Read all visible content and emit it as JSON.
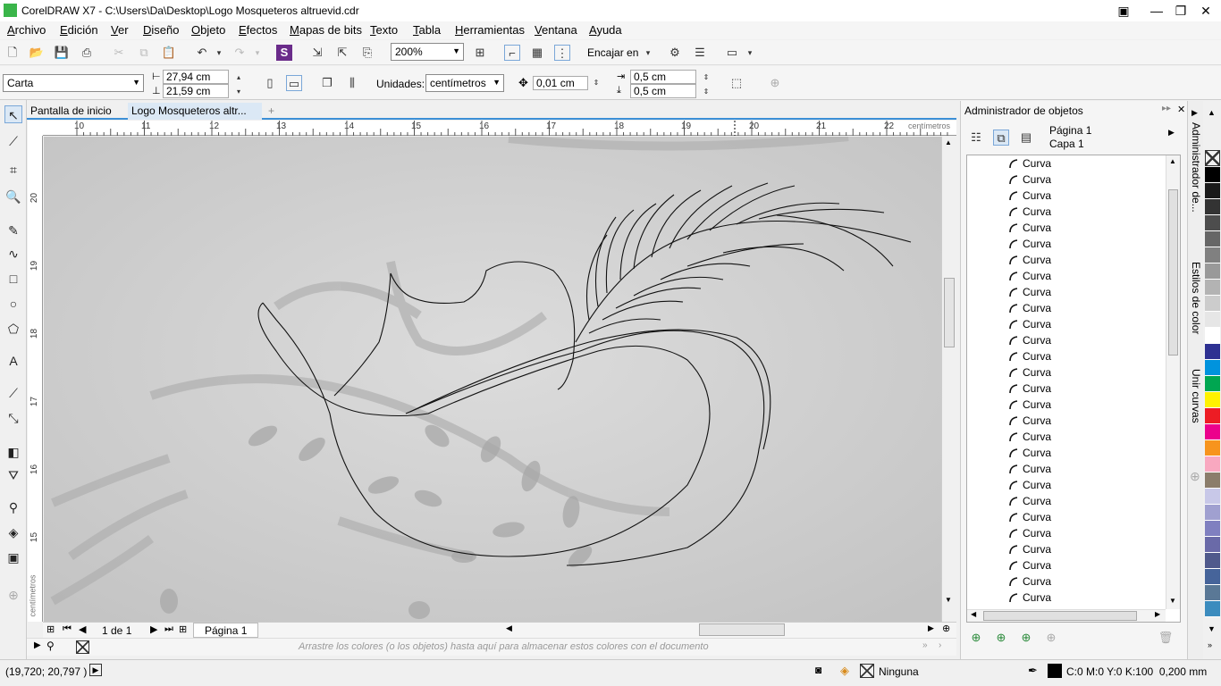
{
  "window": {
    "title": "CorelDRAW X7 - C:\\Users\\Da\\Desktop\\Logo Mosqueteros altruevid.cdr"
  },
  "menu": [
    "Archivo",
    "Edición",
    "Ver",
    "Diseño",
    "Objeto",
    "Efectos",
    "Mapas de bits",
    "Texto",
    "Tabla",
    "Herramientas",
    "Ventana",
    "Ayuda"
  ],
  "toolbar1": {
    "zoom": "200%",
    "snap_label": "Encajar en"
  },
  "toolbar2": {
    "page_size": "Carta",
    "width": "27,94 cm",
    "height": "21,59 cm",
    "units_label": "Unidades:",
    "units": "centímetros",
    "nudge": "0,01 cm",
    "dup_x": "0,5 cm",
    "dup_y": "0,5 cm"
  },
  "doc_tabs": [
    "Pantalla de inicio",
    "Logo Mosqueteros altr..."
  ],
  "ruler": {
    "h_ticks": [
      "10",
      "11",
      "12",
      "13",
      "14",
      "15",
      "16",
      "17",
      "18",
      "19",
      "20",
      "21",
      "22"
    ],
    "h_unit": "centímetros",
    "v_ticks": [
      "20",
      "19",
      "18",
      "17",
      "16",
      "15"
    ],
    "v_unit": "centímetros"
  },
  "pagebar": {
    "page_count": "1 de 1",
    "page_tab": "Página 1"
  },
  "palette_hint": "Arrastre los colores (o los objetos) hasta aquí para almacenar estos colores con el documento",
  "status": {
    "coords": "(19,720; 20,797 )",
    "fill": "Ninguna",
    "outline": "C:0 M:0 Y:0 K:100  0,200 mm"
  },
  "docker": {
    "title": "Administrador de objetos",
    "page": "Página 1",
    "layer": "Capa 1",
    "items": [
      "Curva",
      "Curva",
      "Curva",
      "Curva",
      "Curva",
      "Curva",
      "Curva",
      "Curva",
      "Curva",
      "Curva",
      "Curva",
      "Curva",
      "Curva",
      "Curva",
      "Curva",
      "Curva",
      "Curva",
      "Curva",
      "Curva",
      "Curva",
      "Curva",
      "Curva",
      "Curva",
      "Curva",
      "Curva",
      "Curva",
      "Curva",
      "Curva"
    ]
  },
  "docker_tabs": [
    "Administrador de...",
    "Estilos de color",
    "Unir curvas"
  ],
  "palette_colors": [
    "#000000",
    "#1a1a1a",
    "#333333",
    "#4d4d4d",
    "#666666",
    "#808080",
    "#999999",
    "#b3b3b3",
    "#cccccc",
    "#e6e6e6",
    "#ffffff",
    "#2e3192",
    "#0093dd",
    "#00a651",
    "#fff200",
    "#ed1c24",
    "#ec008c",
    "#f7941d",
    "#f9a8c0",
    "#8b7d6b",
    "#c8c8e8",
    "#a0a0d0",
    "#8080c0",
    "#6a6aa8",
    "#505a8c",
    "#46649a",
    "#5a7896",
    "#3c8cbe"
  ]
}
